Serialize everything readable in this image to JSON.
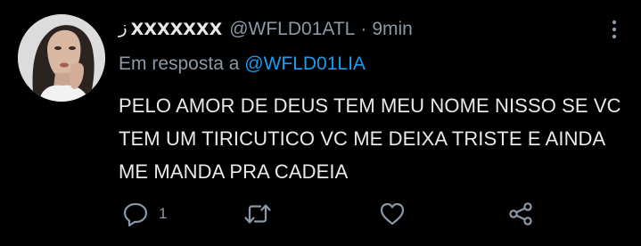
{
  "tweet": {
    "name_prefix": "ز",
    "display_name": "XXXXXXX",
    "handle": "@WFLD01ATL",
    "separator": "·",
    "time": "9min",
    "reply_prefix": "Em resposta a",
    "reply_to": "@WFLD01LIA",
    "text": "PELO AMOR DE DEUS TEM MEU NOME NISSO SE VC TEM UM TIRICUTICO VC ME DEIXA TRISTE E AINDA ME MANDA PRA CADEIA",
    "reply_count": "1"
  },
  "icons": {
    "more": "vertical-ellipsis-icon",
    "reply": "comment-icon",
    "retweet": "retweet-icon",
    "like": "heart-icon",
    "share": "share-icon"
  },
  "colors": {
    "background": "#000000",
    "text": "#e7e9ea",
    "muted": "#8b98a5",
    "mention": "#1d9bf0"
  }
}
